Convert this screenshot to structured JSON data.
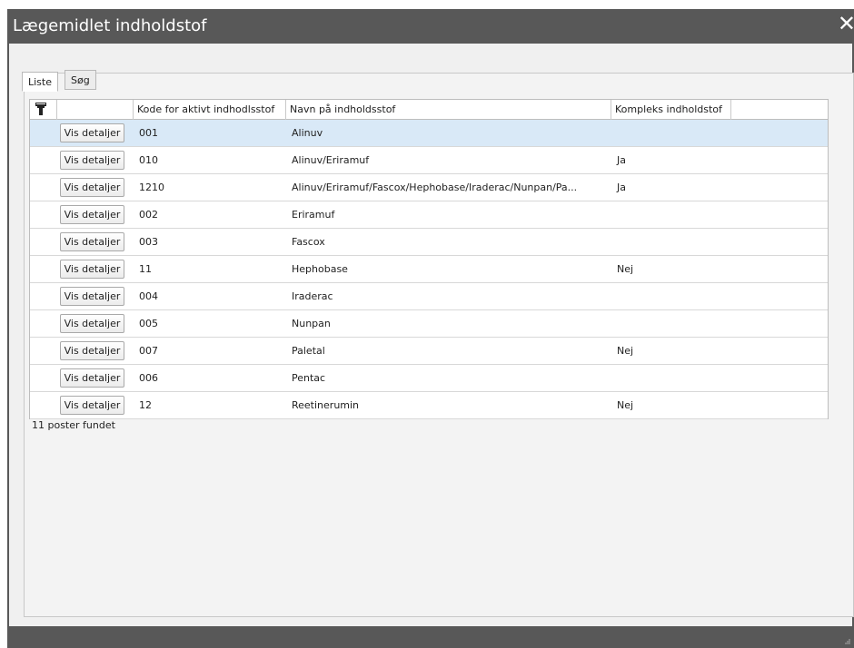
{
  "window": {
    "title": "Lægemidlet indholdstof",
    "close_label": "✕"
  },
  "tabs": [
    {
      "label": "Liste",
      "active": true
    },
    {
      "label": "Søg",
      "active": false
    }
  ],
  "table": {
    "columns": [
      "Kode for aktivt indhodlsstof",
      "Navn på indholdsstof",
      "Kompleks indholdstof"
    ],
    "button_label": "Vis detaljer",
    "rows": [
      {
        "code": "001",
        "name": "Alinuv",
        "complex": "",
        "selected": true
      },
      {
        "code": "010",
        "name": "Alinuv/Eriramuf",
        "complex": "Ja"
      },
      {
        "code": "1210",
        "name": "Alinuv/Eriramuf/Fascox/Hephobase/Iraderac/Nunpan/Pa...",
        "complex": "Ja"
      },
      {
        "code": "002",
        "name": "Eriramuf",
        "complex": ""
      },
      {
        "code": "003",
        "name": "Fascox",
        "complex": ""
      },
      {
        "code": "11",
        "name": "Hephobase",
        "complex": "Nej"
      },
      {
        "code": "004",
        "name": "Iraderac",
        "complex": ""
      },
      {
        "code": "005",
        "name": "Nunpan",
        "complex": ""
      },
      {
        "code": "007",
        "name": "Paletal",
        "complex": "Nej"
      },
      {
        "code": "006",
        "name": "Pentac",
        "complex": ""
      },
      {
        "code": "12",
        "name": "Reetinerumin",
        "complex": "Nej"
      }
    ]
  },
  "status_text": "11 poster fundet",
  "colors": {
    "titlebar": "#585858",
    "selected_row": "#d9e9f7"
  }
}
